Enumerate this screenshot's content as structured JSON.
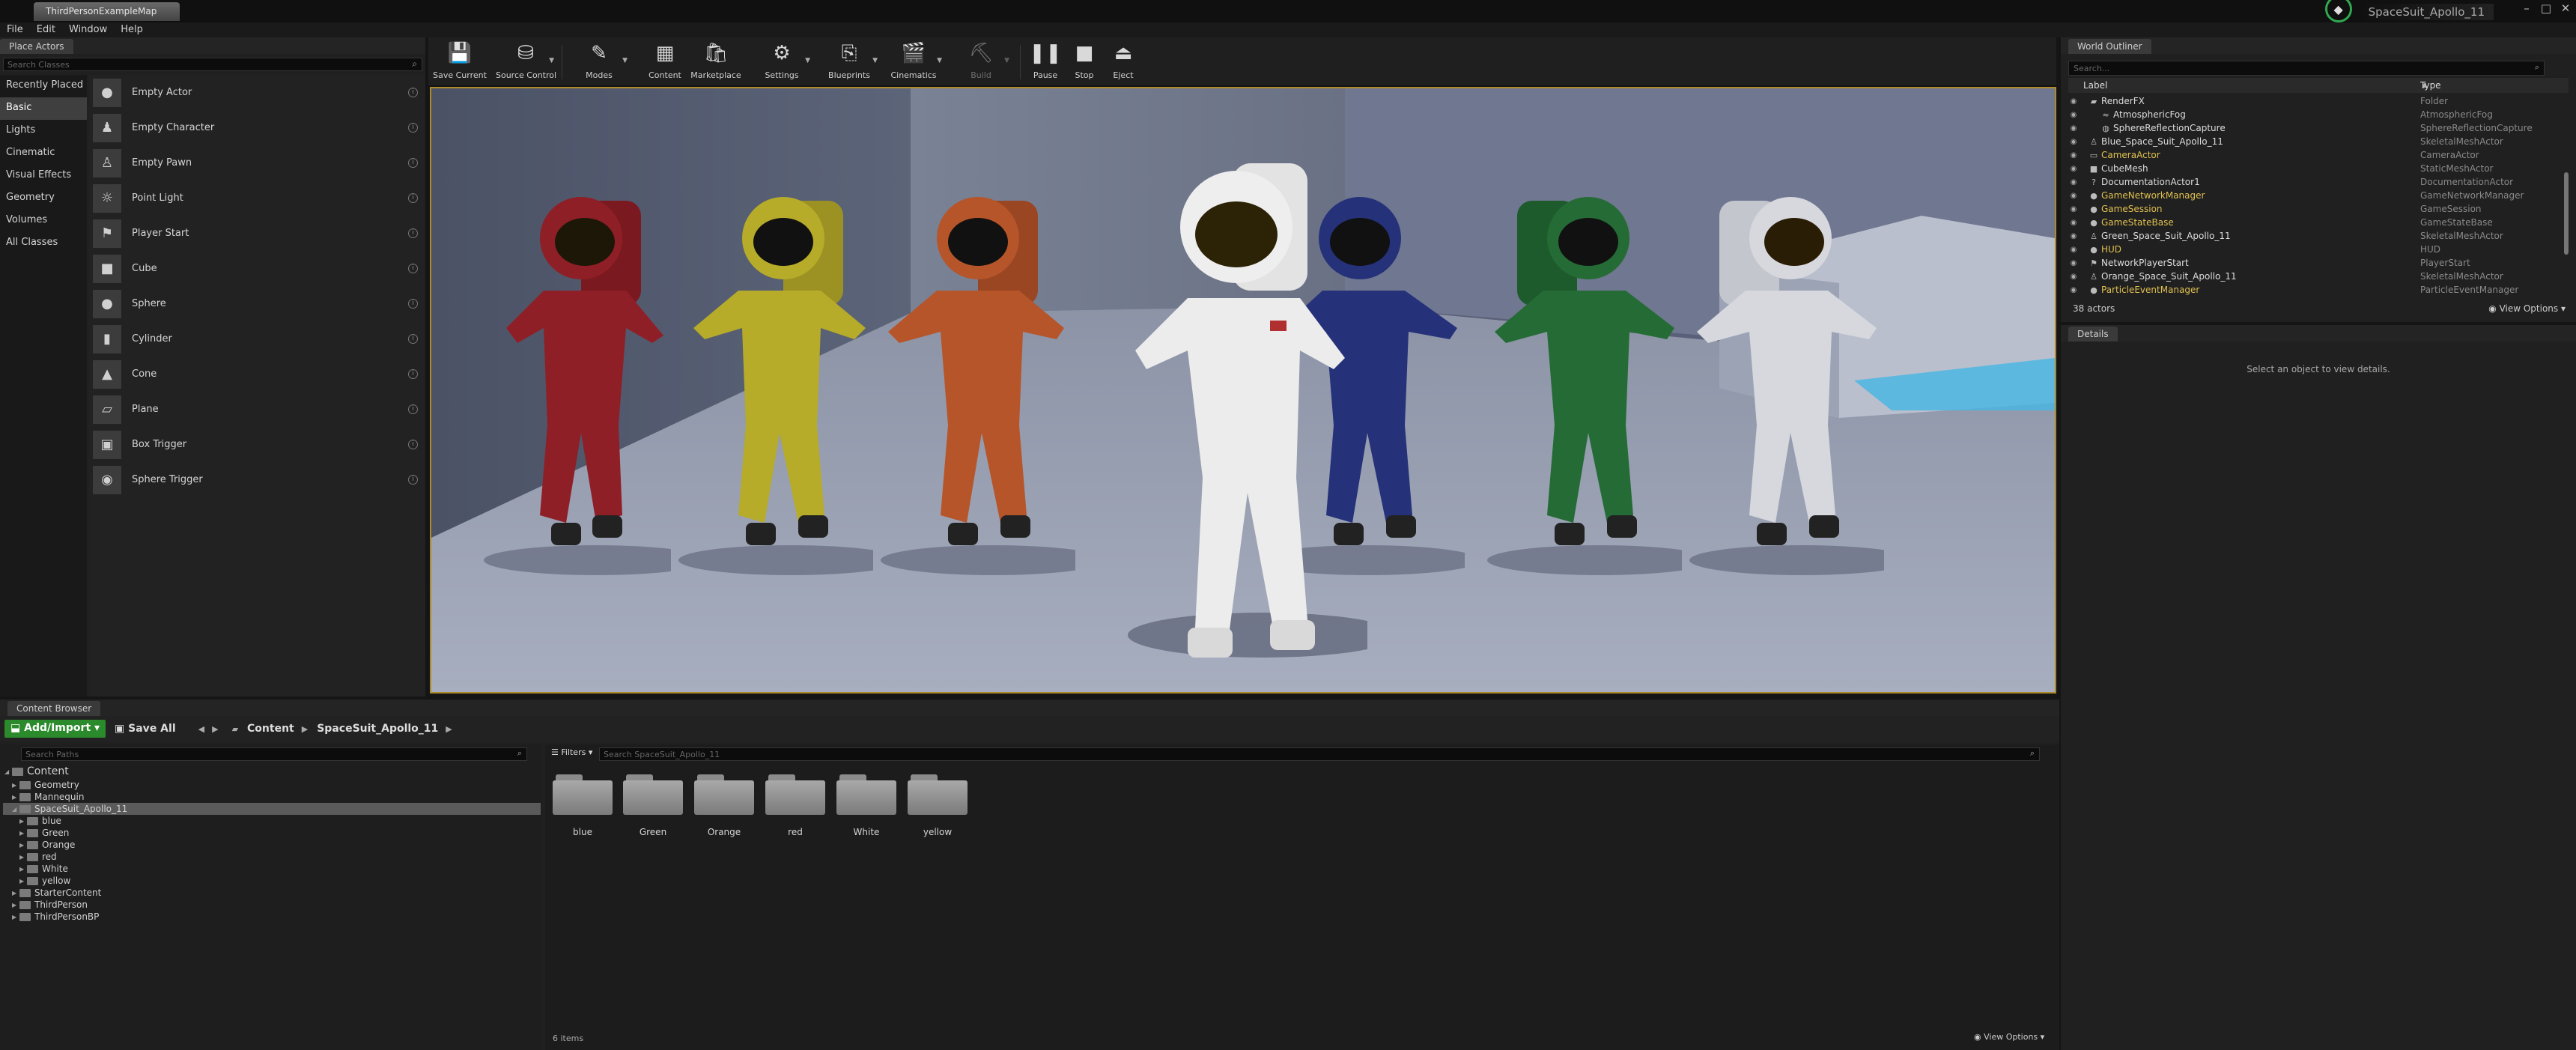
{
  "window": {
    "doc_tab": "ThirdPersonExampleMap",
    "project_name": "SpaceSuit_Apollo_11",
    "controls": {
      "minimize": "–",
      "maximize": "□",
      "close": "✕"
    }
  },
  "menu": [
    "File",
    "Edit",
    "Window",
    "Help"
  ],
  "place_actors": {
    "tab": "Place Actors",
    "search_placeholder": "Search Classes",
    "categories": [
      "Recently Placed",
      "Basic",
      "Lights",
      "Cinematic",
      "Visual Effects",
      "Geometry",
      "Volumes",
      "All Classes"
    ],
    "active_category": "Basic",
    "items": [
      "Empty Actor",
      "Empty Character",
      "Empty Pawn",
      "Point Light",
      "Player Start",
      "Cube",
      "Sphere",
      "Cylinder",
      "Cone",
      "Plane",
      "Box Trigger",
      "Sphere Trigger"
    ],
    "item_icons": [
      "empty-actor-icon",
      "character-icon",
      "pawn-icon",
      "light-bulb-icon",
      "player-start-icon",
      "cube-icon",
      "sphere-icon",
      "cylinder-icon",
      "cone-icon",
      "plane-icon",
      "box-trigger-icon",
      "sphere-trigger-icon"
    ]
  },
  "toolbar": [
    {
      "label": "Save Current",
      "icon": "save-icon"
    },
    {
      "label": "Source Control",
      "icon": "source-control-icon"
    },
    {
      "label": "Modes",
      "icon": "modes-icon"
    },
    {
      "label": "Content",
      "icon": "content-icon"
    },
    {
      "label": "Marketplace",
      "icon": "marketplace-icon"
    },
    {
      "label": "Settings",
      "icon": "settings-icon"
    },
    {
      "label": "Blueprints",
      "icon": "blueprints-icon"
    },
    {
      "label": "Cinematics",
      "icon": "cinematics-icon"
    },
    {
      "label": "Build",
      "icon": "build-icon"
    },
    {
      "label": "Pause",
      "icon": "pause-icon"
    },
    {
      "label": "Stop",
      "icon": "stop-icon"
    },
    {
      "label": "Eject",
      "icon": "eject-icon"
    }
  ],
  "outliner": {
    "tab": "World Outliner",
    "search_placeholder": "Search...",
    "col_label": "Label",
    "col_type": "Type",
    "rows": [
      {
        "label": "RenderFX",
        "type": "Folder"
      },
      {
        "label": "AtmosphericFog",
        "type": "AtmosphericFog"
      },
      {
        "label": "SphereReflectionCapture",
        "type": "SphereReflectionCapture"
      },
      {
        "label": "Blue_Space_Suit_Apollo_11",
        "type": "SkeletalMeshActor"
      },
      {
        "label": "CameraActor",
        "type": "CameraActor"
      },
      {
        "label": "CubeMesh",
        "type": "StaticMeshActor"
      },
      {
        "label": "DocumentationActor1",
        "type": "DocumentationActor"
      },
      {
        "label": "GameNetworkManager",
        "type": "GameNetworkManager"
      },
      {
        "label": "GameSession",
        "type": "GameSession"
      },
      {
        "label": "GameStateBase",
        "type": "GameStateBase"
      },
      {
        "label": "Green_Space_Suit_Apollo_11",
        "type": "SkeletalMeshActor"
      },
      {
        "label": "HUD",
        "type": "HUD"
      },
      {
        "label": "NetworkPlayerStart",
        "type": "PlayerStart"
      },
      {
        "label": "Orange_Space_Suit_Apollo_11",
        "type": "SkeletalMeshActor"
      },
      {
        "label": "ParticleEventManager",
        "type": "ParticleEventManager"
      }
    ],
    "actor_count": "38 actors",
    "view_options": "View Options"
  },
  "details": {
    "tab": "Details",
    "message": "Select an object to view details."
  },
  "content_browser": {
    "tab": "Content Browser",
    "add_import": "Add/Import",
    "save_all": "Save All",
    "breadcrumbs": [
      "Content",
      "SpaceSuit_Apollo_11"
    ],
    "search_paths_placeholder": "Search Paths",
    "tree": [
      {
        "label": "Content"
      },
      {
        "label": "Geometry"
      },
      {
        "label": "Mannequin"
      },
      {
        "label": "SpaceSuit_Apollo_11"
      },
      {
        "label": "blue"
      },
      {
        "label": "Green"
      },
      {
        "label": "Orange"
      },
      {
        "label": "red"
      },
      {
        "label": "White"
      },
      {
        "label": "yellow"
      },
      {
        "label": "StarterContent"
      },
      {
        "label": "ThirdPerson"
      },
      {
        "label": "ThirdPersonBP"
      }
    ],
    "filters": "Filters",
    "search_assets_placeholder": "Search SpaceSuit_Apollo_11",
    "assets": [
      "blue",
      "Green",
      "Orange",
      "red",
      "White",
      "yellow"
    ],
    "item_count": "6 items",
    "view_options": "View Options"
  },
  "colors": {
    "accent_selection": "#ae8a2a",
    "add_button": "#2b8a2b",
    "outliner_gold": "#e0c050",
    "suit_colors": [
      "#8f1f26",
      "#b7ab2a",
      "#b6552a",
      "#e9e9e9",
      "#25327a",
      "#246b35",
      "#d6d8de"
    ]
  }
}
